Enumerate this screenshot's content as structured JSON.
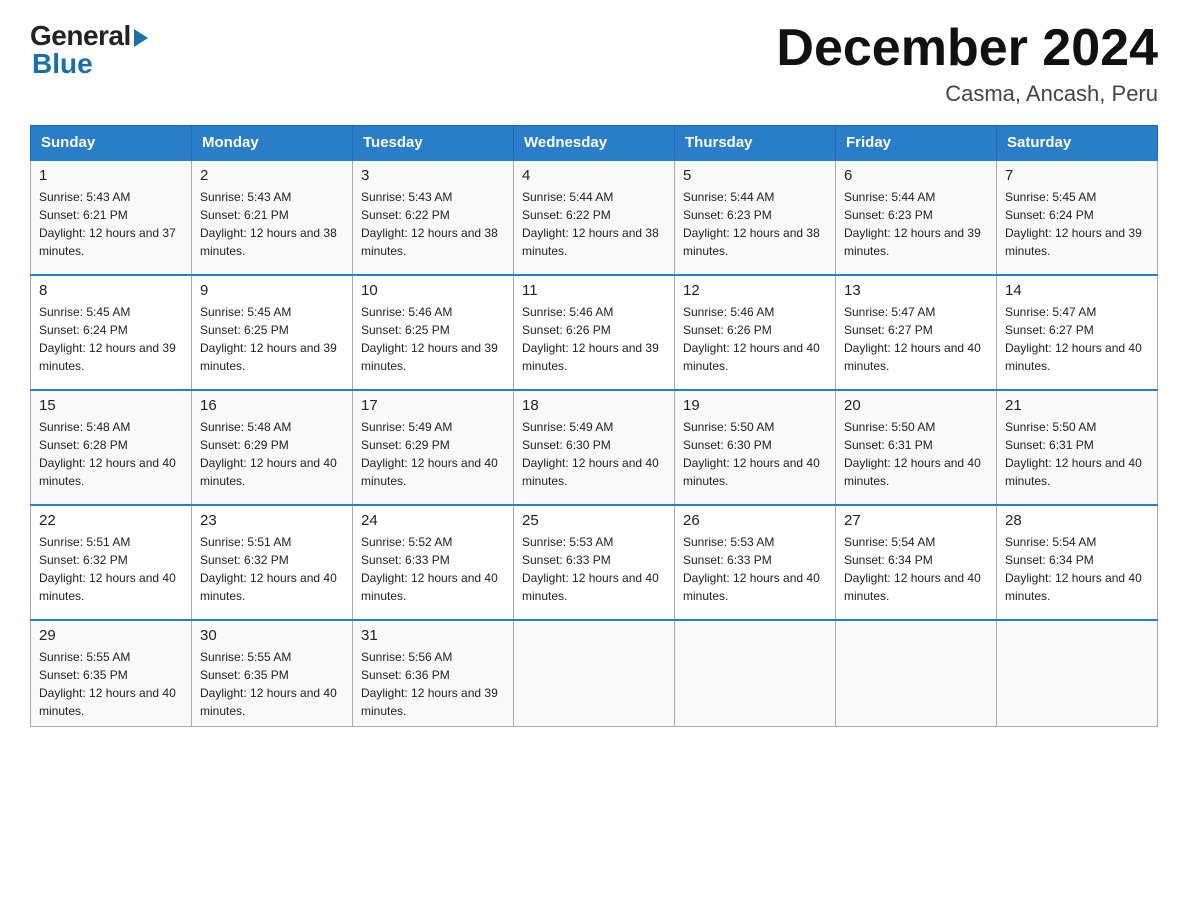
{
  "header": {
    "logo_general": "General",
    "logo_blue": "Blue",
    "title": "December 2024",
    "subtitle": "Casma, Ancash, Peru"
  },
  "days_of_week": [
    "Sunday",
    "Monday",
    "Tuesday",
    "Wednesday",
    "Thursday",
    "Friday",
    "Saturday"
  ],
  "weeks": [
    [
      {
        "day": "1",
        "sunrise": "5:43 AM",
        "sunset": "6:21 PM",
        "daylight": "12 hours and 37 minutes."
      },
      {
        "day": "2",
        "sunrise": "5:43 AM",
        "sunset": "6:21 PM",
        "daylight": "12 hours and 38 minutes."
      },
      {
        "day": "3",
        "sunrise": "5:43 AM",
        "sunset": "6:22 PM",
        "daylight": "12 hours and 38 minutes."
      },
      {
        "day": "4",
        "sunrise": "5:44 AM",
        "sunset": "6:22 PM",
        "daylight": "12 hours and 38 minutes."
      },
      {
        "day": "5",
        "sunrise": "5:44 AM",
        "sunset": "6:23 PM",
        "daylight": "12 hours and 38 minutes."
      },
      {
        "day": "6",
        "sunrise": "5:44 AM",
        "sunset": "6:23 PM",
        "daylight": "12 hours and 39 minutes."
      },
      {
        "day": "7",
        "sunrise": "5:45 AM",
        "sunset": "6:24 PM",
        "daylight": "12 hours and 39 minutes."
      }
    ],
    [
      {
        "day": "8",
        "sunrise": "5:45 AM",
        "sunset": "6:24 PM",
        "daylight": "12 hours and 39 minutes."
      },
      {
        "day": "9",
        "sunrise": "5:45 AM",
        "sunset": "6:25 PM",
        "daylight": "12 hours and 39 minutes."
      },
      {
        "day": "10",
        "sunrise": "5:46 AM",
        "sunset": "6:25 PM",
        "daylight": "12 hours and 39 minutes."
      },
      {
        "day": "11",
        "sunrise": "5:46 AM",
        "sunset": "6:26 PM",
        "daylight": "12 hours and 39 minutes."
      },
      {
        "day": "12",
        "sunrise": "5:46 AM",
        "sunset": "6:26 PM",
        "daylight": "12 hours and 40 minutes."
      },
      {
        "day": "13",
        "sunrise": "5:47 AM",
        "sunset": "6:27 PM",
        "daylight": "12 hours and 40 minutes."
      },
      {
        "day": "14",
        "sunrise": "5:47 AM",
        "sunset": "6:27 PM",
        "daylight": "12 hours and 40 minutes."
      }
    ],
    [
      {
        "day": "15",
        "sunrise": "5:48 AM",
        "sunset": "6:28 PM",
        "daylight": "12 hours and 40 minutes."
      },
      {
        "day": "16",
        "sunrise": "5:48 AM",
        "sunset": "6:29 PM",
        "daylight": "12 hours and 40 minutes."
      },
      {
        "day": "17",
        "sunrise": "5:49 AM",
        "sunset": "6:29 PM",
        "daylight": "12 hours and 40 minutes."
      },
      {
        "day": "18",
        "sunrise": "5:49 AM",
        "sunset": "6:30 PM",
        "daylight": "12 hours and 40 minutes."
      },
      {
        "day": "19",
        "sunrise": "5:50 AM",
        "sunset": "6:30 PM",
        "daylight": "12 hours and 40 minutes."
      },
      {
        "day": "20",
        "sunrise": "5:50 AM",
        "sunset": "6:31 PM",
        "daylight": "12 hours and 40 minutes."
      },
      {
        "day": "21",
        "sunrise": "5:50 AM",
        "sunset": "6:31 PM",
        "daylight": "12 hours and 40 minutes."
      }
    ],
    [
      {
        "day": "22",
        "sunrise": "5:51 AM",
        "sunset": "6:32 PM",
        "daylight": "12 hours and 40 minutes."
      },
      {
        "day": "23",
        "sunrise": "5:51 AM",
        "sunset": "6:32 PM",
        "daylight": "12 hours and 40 minutes."
      },
      {
        "day": "24",
        "sunrise": "5:52 AM",
        "sunset": "6:33 PM",
        "daylight": "12 hours and 40 minutes."
      },
      {
        "day": "25",
        "sunrise": "5:53 AM",
        "sunset": "6:33 PM",
        "daylight": "12 hours and 40 minutes."
      },
      {
        "day": "26",
        "sunrise": "5:53 AM",
        "sunset": "6:33 PM",
        "daylight": "12 hours and 40 minutes."
      },
      {
        "day": "27",
        "sunrise": "5:54 AM",
        "sunset": "6:34 PM",
        "daylight": "12 hours and 40 minutes."
      },
      {
        "day": "28",
        "sunrise": "5:54 AM",
        "sunset": "6:34 PM",
        "daylight": "12 hours and 40 minutes."
      }
    ],
    [
      {
        "day": "29",
        "sunrise": "5:55 AM",
        "sunset": "6:35 PM",
        "daylight": "12 hours and 40 minutes."
      },
      {
        "day": "30",
        "sunrise": "5:55 AM",
        "sunset": "6:35 PM",
        "daylight": "12 hours and 40 minutes."
      },
      {
        "day": "31",
        "sunrise": "5:56 AM",
        "sunset": "6:36 PM",
        "daylight": "12 hours and 39 minutes."
      },
      null,
      null,
      null,
      null
    ]
  ],
  "labels": {
    "sunrise": "Sunrise:",
    "sunset": "Sunset:",
    "daylight": "Daylight:"
  }
}
